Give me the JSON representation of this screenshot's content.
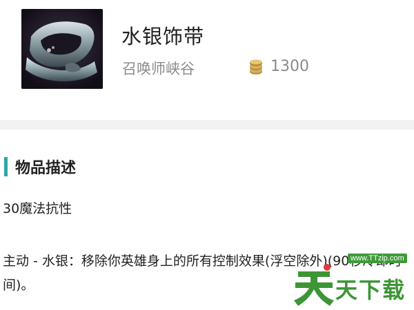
{
  "item": {
    "name": "水银饰带",
    "map": "召唤师峡谷",
    "price": "1300",
    "icon": "quicksilver-sash-icon",
    "price_icon": "gold-coins-icon"
  },
  "description": {
    "title": "物品描述",
    "stat": "30魔法抗性",
    "active": "主动 - 水银：移除你英雄身上的所有控制效果(浮空除外)(90秒冷却时间)。"
  },
  "watermark": {
    "url": "www.TTzip.com",
    "text": "天下载"
  },
  "colors": {
    "accent": "#2ca7a0",
    "gold": "#c9a24a",
    "watermark_green": "#3d9536"
  }
}
